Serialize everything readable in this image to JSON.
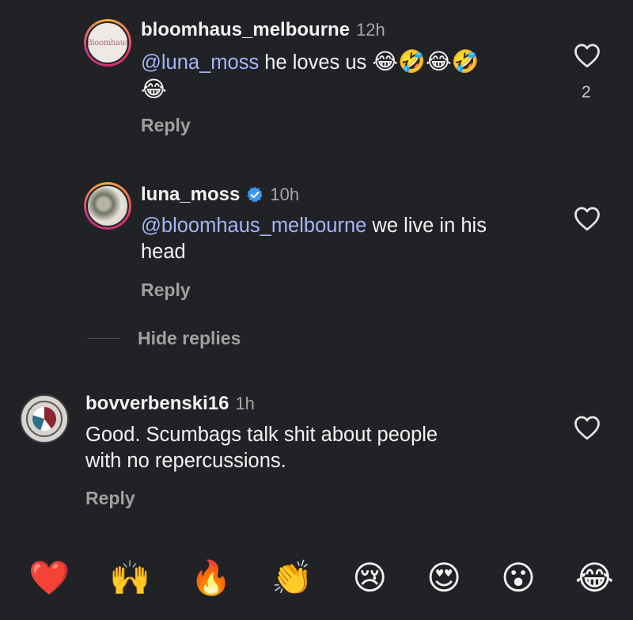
{
  "comments": [
    {
      "username": "bloomhaus_melbourne",
      "time": "12h",
      "mention": "@luna_moss",
      "text": " he loves us",
      "emojis": "😂🤣😂🤣",
      "emojis_line2": "😂",
      "likes": "2",
      "reply_label": "Reply",
      "avatar_text": "Bloomhaus"
    },
    {
      "username": "luna_moss",
      "verified": true,
      "time": "10h",
      "mention": "@bloomhaus_melbourne",
      "text": " we live in his",
      "text_line2": "head",
      "reply_label": "Reply"
    },
    {
      "username": "bovverbenski16",
      "time": "1h",
      "text": "Good. Scumbags talk shit about people",
      "text_line2": "with no repercussions.",
      "reply_label": "Reply"
    }
  ],
  "hide_replies_label": "Hide replies",
  "quick_reactions": [
    "❤️",
    "🙌",
    "🔥",
    "👏",
    "😢",
    "😍",
    "😮",
    "😂"
  ],
  "colors": {
    "background": "#202226",
    "mention": "#a4b6f5",
    "verified": "#3897f0",
    "muted": "#a0a0a0"
  },
  "icons": [
    "heart-outline-icon",
    "verified-badge-icon"
  ]
}
